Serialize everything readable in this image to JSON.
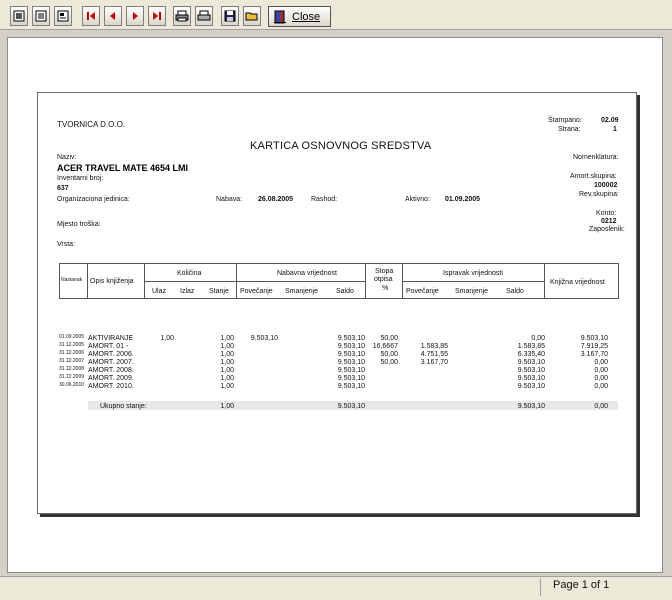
{
  "toolbar": {
    "buttons": [
      {
        "name": "whole-page-icon"
      },
      {
        "name": "page-width-icon"
      },
      {
        "name": "zoom-icon"
      },
      {
        "name": "first-page-icon"
      },
      {
        "name": "prev-page-icon"
      },
      {
        "name": "next-page-icon"
      },
      {
        "name": "last-page-icon"
      },
      {
        "name": "print-setup-icon"
      },
      {
        "name": "print-icon"
      },
      {
        "name": "save-icon"
      },
      {
        "name": "open-icon"
      }
    ],
    "close_label": "Close",
    "close_icon": "close-door-icon"
  },
  "report": {
    "company": "TVORNICA D.O.O.",
    "stampano_label": "Štampano:",
    "stampano_value": "02.09",
    "strana_label": "Strana:",
    "strana_value": "1",
    "title": "KARTICA OSNOVNOG SREDSTVA",
    "naziv_label": "Naziv:",
    "asset_name": "ACER TRAVEL MATE 4654 LMI",
    "inventarni_label": "Inventarni broj:",
    "inventarni_value": "637",
    "org_label": "Organizaciona jedinica:",
    "nabava_label": "Nabava:",
    "nabava_value": "26.08.2005",
    "rashod_label": "Rashod:",
    "aktivno_label": "Aktivno:",
    "aktivno_value": "01.09.2005",
    "mjesto_label": "Mjesto troška:",
    "vrsta_label": "Vrsta:",
    "nomenklatura_label": "Nomenklatura:",
    "amort_grupa_label": "Amort.skupina:",
    "amort_grupa_value": "100002",
    "revskupina_label": "Rev.skupina:",
    "konto_label": "Konto:",
    "konto_value": "0212",
    "zaposlenik_label": "Zaposlenik:",
    "columns": {
      "nastanak": "Nastanak",
      "opis": "Opis knjiženja",
      "kolicina": "Količina",
      "ulaz": "Ulaz",
      "izlaz": "Izlaz",
      "stanje": "Stanje",
      "nabavna": "Nabavna vrijednost",
      "povecanje": "Povečanje",
      "smanjenje": "Smanjenje",
      "saldo": "Saldo",
      "stopa": "Stopa",
      "otpisa": "otpisa",
      "pct": "%",
      "ispravak": "Ispravak vrijednosti",
      "isp_povecanje": "Povečanje",
      "isp_smanjenje": "Smanjenje",
      "isp_saldo": "Saldo",
      "knjizna": "Knjižna vrijednost"
    },
    "rows": [
      {
        "date": "01.09.2005",
        "opis": "AKTIVIRANJE",
        "ulaz": "1,00",
        "stanje": "1,00",
        "nab_pov": "9.503,10",
        "nab_saldo": "9.503,10",
        "stopa": "50,00",
        "isp_pov": "",
        "isp_saldo": "0,00",
        "knj": "9.503,10"
      },
      {
        "date": "31.12.2005",
        "opis": "AMORT. 01 -",
        "ulaz": "",
        "stanje": "1,00",
        "nab_pov": "",
        "nab_saldo": "9.503,10",
        "stopa": "16,6667",
        "isp_pov": "1.583,85",
        "isp_saldo": "1.583,85",
        "knj": "7.919,25"
      },
      {
        "date": "31.12.2006",
        "opis": "AMORT. 2006.",
        "ulaz": "",
        "stanje": "1,00",
        "nab_pov": "",
        "nab_saldo": "9.503,10",
        "stopa": "50,00",
        "isp_pov": "4.751,55",
        "isp_saldo": "6.335,40",
        "knj": "3.167,70"
      },
      {
        "date": "31.12.2007",
        "opis": "AMORT. 2007.",
        "ulaz": "",
        "stanje": "1,00",
        "nab_pov": "",
        "nab_saldo": "9.503,10",
        "stopa": "50,00",
        "isp_pov": "3.167,70",
        "isp_saldo": "9.503,10",
        "knj": "0,00"
      },
      {
        "date": "31.12.2008",
        "opis": "AMORT. 2008.",
        "ulaz": "",
        "stanje": "1,00",
        "nab_pov": "",
        "nab_saldo": "9.503,10",
        "stopa": "",
        "isp_pov": "",
        "isp_saldo": "9.503,10",
        "knj": "0,00"
      },
      {
        "date": "31.12.2009",
        "opis": "AMORT. 2009.",
        "ulaz": "",
        "stanje": "1,00",
        "nab_pov": "",
        "nab_saldo": "9.503,10",
        "stopa": "",
        "isp_pov": "",
        "isp_saldo": "9.503,10",
        "knj": "0,00"
      },
      {
        "date": "30.06.2010",
        "opis": "AMORT. 2010.",
        "ulaz": "",
        "stanje": "1,00",
        "nab_pov": "",
        "nab_saldo": "9.503,10",
        "stopa": "",
        "isp_pov": "",
        "isp_saldo": "9.503,10",
        "knj": "0,00"
      }
    ],
    "totals": {
      "label": "Ukupno stanje:",
      "stanje": "1,00",
      "nab_saldo": "9.503,10",
      "isp_saldo": "9.503,10",
      "knj": "0,00"
    }
  },
  "status": {
    "page_text": "Page 1 of 1"
  }
}
